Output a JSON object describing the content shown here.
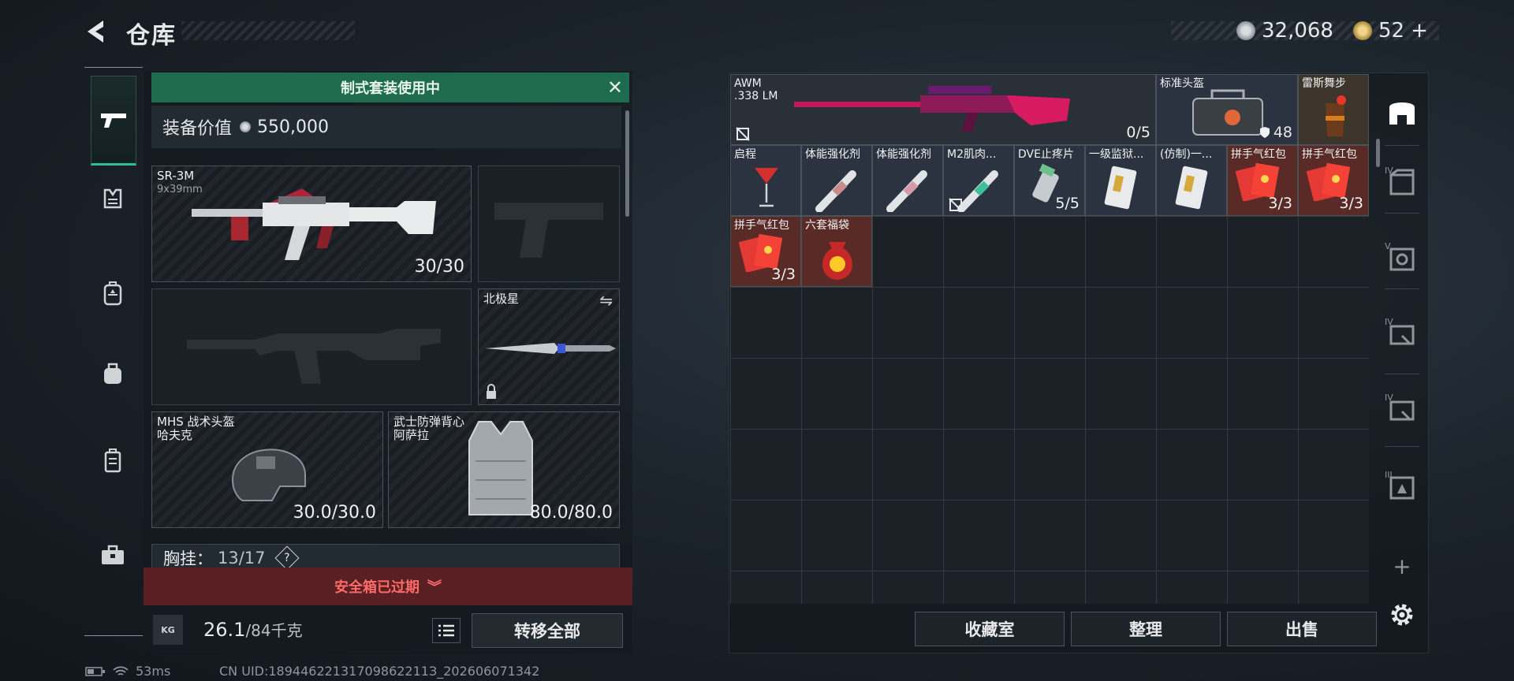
{
  "header": {
    "title": "仓库"
  },
  "currency": {
    "silver": "32,068",
    "gold": "52",
    "gold_plus": "+"
  },
  "suit_banner": {
    "text": "制式套装使用中"
  },
  "equip_value": {
    "label": "装备价值",
    "value": "550,000"
  },
  "slots": {
    "primary": {
      "name": "SR-3M",
      "ammo": "9x39mm",
      "count": "30/30"
    },
    "melee": {
      "name": "北极星"
    },
    "helmet": {
      "name": "MHS 战术头盔",
      "sub": "哈夫克",
      "count": "30.0/30.0"
    },
    "armor": {
      "name": "武士防弹背心",
      "sub": "阿萨拉",
      "count": "80.0/80.0"
    }
  },
  "chest_rig": {
    "label": "胸挂：",
    "value": "13/17",
    "help": "?"
  },
  "safe_box": {
    "text": "安全箱已过期"
  },
  "weight": {
    "current": "26.1",
    "max": "/84千克",
    "icon_text": "KG"
  },
  "transfer_all": "转移全部",
  "status_bar": {
    "ping": "53ms",
    "uid": "CN UID:18944622131709862211З_202606071342"
  },
  "items": [
    {
      "name": "AWM",
      "sub": ".338 LM",
      "count": "0/5"
    },
    {
      "name": "标准头盔",
      "count": "48"
    },
    {
      "name": "雷斯舞步"
    },
    {
      "name": "启程"
    },
    {
      "name": "体能强化剂"
    },
    {
      "name": "体能强化剂"
    },
    {
      "name": "M2肌肉..."
    },
    {
      "name": "DVE止疼片",
      "count": "5/5"
    },
    {
      "name": "一级监狱..."
    },
    {
      "name": "(仿制)一..."
    },
    {
      "name": "拼手气红包",
      "count": "3/3"
    },
    {
      "name": "拼手气红包",
      "count": "3/3"
    },
    {
      "name": "拼手气红包",
      "count": "3/3"
    },
    {
      "name": "六套福袋"
    }
  ],
  "bottom_buttons": {
    "collection": "收藏室",
    "organize": "整理",
    "sell": "出售"
  },
  "right_nav": {
    "tiers": [
      "IV",
      "V",
      "IV",
      "IV",
      "III"
    ],
    "add": "+"
  },
  "colors": {
    "accent_green": "#2fbf93",
    "banner_green": "#1e6b50",
    "danger_red": "#ff6b6b",
    "red_item_bg": "#5a2a26"
  }
}
